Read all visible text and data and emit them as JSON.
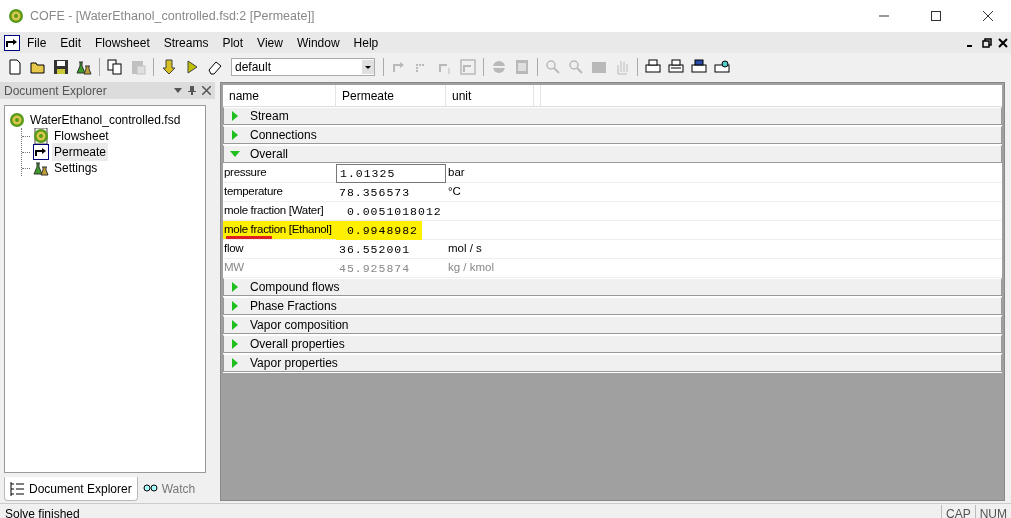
{
  "window": {
    "title": "COFE - [WaterEthanol_controlled.fsd:2 [Permeate]]"
  },
  "menu": [
    "File",
    "Edit",
    "Flowsheet",
    "Streams",
    "Plot",
    "View",
    "Window",
    "Help"
  ],
  "toolbar": {
    "buttons": [
      {
        "disabled": false
      },
      {
        "disabled": false
      },
      {
        "disabled": false
      },
      {
        "disabled": false
      },
      {
        "disabled": false
      },
      {
        "disabled": true
      },
      {
        "disabled": false
      },
      {
        "disabled": false
      },
      {
        "disabled": false
      }
    ],
    "combo": {
      "value": "default"
    },
    "buttons2": [
      {
        "disabled": true
      },
      {
        "disabled": true
      },
      {
        "disabled": true
      },
      {
        "disabled": true
      },
      {
        "disabled": true
      },
      {
        "disabled": true
      },
      {
        "disabled": true
      },
      {
        "disabled": true
      },
      {
        "disabled": true
      },
      {
        "disabled": true
      },
      {
        "disabled": false
      },
      {
        "disabled": false
      },
      {
        "disabled": false
      },
      {
        "disabled": false
      }
    ]
  },
  "explorer": {
    "title": "Document Explorer",
    "tree": [
      {
        "label": "WaterEthanol_controlled.fsd",
        "selected": false,
        "children": [
          {
            "label": "Flowsheet",
            "selected": false
          },
          {
            "label": "Permeate",
            "selected": true
          },
          {
            "label": "Settings",
            "selected": false
          }
        ]
      }
    ],
    "tabs": [
      {
        "label": "Document Explorer",
        "selected": true
      },
      {
        "label": "Watch",
        "selected": false
      }
    ]
  },
  "grid": {
    "columns": [
      "name",
      "Permeate",
      "unit"
    ],
    "rows": [
      {
        "kind": "section",
        "label": "Stream",
        "expanded": false
      },
      {
        "kind": "section",
        "label": "Connections",
        "expanded": false
      },
      {
        "kind": "section",
        "label": "Overall",
        "expanded": true
      },
      {
        "kind": "property",
        "name": "pressure",
        "value": "1.01325",
        "unit": "bar",
        "focused": true,
        "highlighted": false,
        "disabled": false
      },
      {
        "kind": "property",
        "name": "temperature",
        "value": "78.356573",
        "unit": "°C",
        "focused": false,
        "highlighted": false,
        "disabled": false
      },
      {
        "kind": "property",
        "name": "mole fraction [Water]",
        "value": " 0.0051018012",
        "unit": "",
        "focused": false,
        "highlighted": false,
        "disabled": false
      },
      {
        "kind": "property",
        "name": "mole fraction [Ethanol]",
        "value": " 0.9948982",
        "unit": "",
        "focused": false,
        "highlighted": true,
        "disabled": false
      },
      {
        "kind": "property",
        "name": "flow",
        "value": "36.552001",
        "unit": "mol / s",
        "focused": false,
        "highlighted": false,
        "disabled": false
      },
      {
        "kind": "property",
        "name": "MW",
        "value": "45.925874",
        "unit": "kg / kmol",
        "focused": false,
        "highlighted": false,
        "disabled": true
      },
      {
        "kind": "section",
        "label": "Compound flows",
        "expanded": false
      },
      {
        "kind": "section",
        "label": "Phase Fractions",
        "expanded": false
      },
      {
        "kind": "section",
        "label": "Vapor composition",
        "expanded": false
      },
      {
        "kind": "section",
        "label": "Overall properties",
        "expanded": false
      },
      {
        "kind": "section",
        "label": "Vapor properties",
        "expanded": false
      }
    ]
  },
  "status_bar": {
    "message": "Solve finished",
    "indicators": [
      "CAP",
      "NUM"
    ]
  }
}
